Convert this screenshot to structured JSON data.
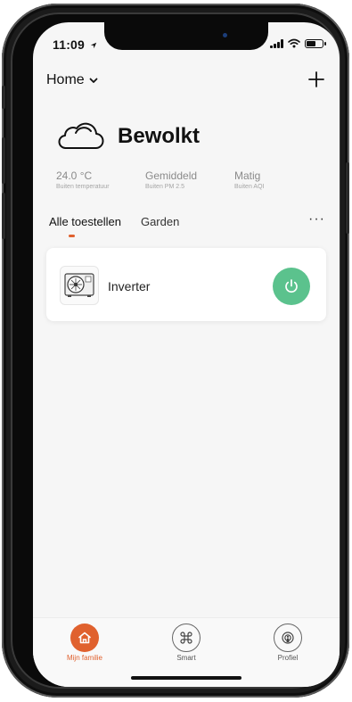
{
  "status_bar": {
    "time": "11:09"
  },
  "header": {
    "home_label": "Home"
  },
  "weather": {
    "condition": "Bewolkt"
  },
  "stats": [
    {
      "value": "24.0 °C",
      "label": "Buiten temperatuur"
    },
    {
      "value": "Gemiddeld",
      "label": "Buiten PM 2.5"
    },
    {
      "value": "Matig",
      "label": "Buiten AQI"
    }
  ],
  "tabs": [
    {
      "label": "Alle toestellen",
      "active": true
    },
    {
      "label": "Garden",
      "active": false
    }
  ],
  "more": "···",
  "devices": [
    {
      "name": "Inverter",
      "icon": "heat-pump-unit-icon",
      "power_color": "#5bc28d"
    }
  ],
  "bottom_nav": [
    {
      "label": "Mijn familie",
      "icon": "home-icon",
      "active": true
    },
    {
      "label": "Smart",
      "icon": "command-icon",
      "active": false
    },
    {
      "label": "Profiel",
      "icon": "profile-icon",
      "active": false
    }
  ],
  "colors": {
    "accent": "#e0612e",
    "power_on": "#5bc28d",
    "background": "#f6f6f6"
  }
}
